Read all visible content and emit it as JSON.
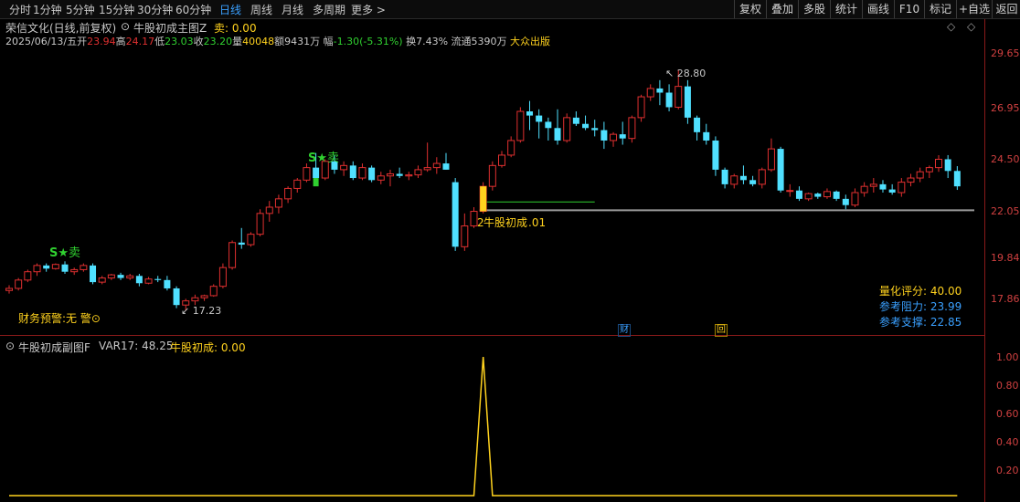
{
  "toolbar": {
    "timeframes": [
      "分时",
      "1分钟",
      "5分钟",
      "15分钟",
      "30分钟",
      "60分钟",
      "日线",
      "周线",
      "月线",
      "多周期",
      "更多"
    ],
    "active_timeframe": "日线",
    "more_arrow": ">",
    "tools": [
      "复权",
      "叠加",
      "多股",
      "统计",
      "画线",
      "F10",
      "标记",
      "+自选",
      "返回"
    ]
  },
  "header": {
    "stock_title": "荣信文化(日线,前复权)",
    "indicator_name": "牛股初成主图Z",
    "indicator_value": "卖: 0.00",
    "date": "2025/06/13/五",
    "open_label": "开",
    "open": "23.94",
    "high_label": "高",
    "high": "24.17",
    "low_label": "低",
    "low": "23.03",
    "close_label": "收",
    "close": "23.20",
    "volume_label": "量",
    "volume": "40048",
    "amount_label": "额",
    "amount": "9431万",
    "change_label": "幅",
    "change": "-1.30(-5.31%)",
    "turnover_label": "换",
    "turnover": "7.43%",
    "float_label": "流通",
    "float": "5390万",
    "sector": "大众出版"
  },
  "y_axis_main": [
    "29.65",
    "26.95",
    "24.50",
    "22.05",
    "19.84",
    "17.86"
  ],
  "y_axis_sub": [
    "1.00",
    "0.80",
    "0.60",
    "0.40",
    "0.20"
  ],
  "chart_data": {
    "type": "candlestick",
    "price_axis_ticks": [
      29.65,
      26.95,
      24.5,
      22.05,
      19.84,
      17.86
    ],
    "ohlc": [
      [
        18.2,
        18.45,
        18.05,
        18.3
      ],
      [
        18.3,
        18.8,
        18.2,
        18.7
      ],
      [
        18.7,
        19.2,
        18.6,
        19.1
      ],
      [
        19.1,
        19.5,
        18.9,
        19.4
      ],
      [
        19.4,
        19.5,
        19.1,
        19.25
      ],
      [
        19.25,
        19.5,
        19.2,
        19.45
      ],
      [
        19.45,
        19.6,
        19.0,
        19.1
      ],
      [
        19.1,
        19.3,
        18.95,
        19.2
      ],
      [
        19.2,
        19.5,
        19.1,
        19.4
      ],
      [
        19.4,
        19.5,
        18.5,
        18.6
      ],
      [
        18.6,
        18.9,
        18.5,
        18.8
      ],
      [
        18.8,
        19.0,
        18.7,
        18.95
      ],
      [
        18.95,
        19.05,
        18.7,
        18.8
      ],
      [
        18.8,
        19.0,
        18.7,
        18.9
      ],
      [
        18.9,
        19.0,
        18.4,
        18.55
      ],
      [
        18.55,
        18.85,
        18.5,
        18.75
      ],
      [
        18.75,
        18.9,
        18.6,
        18.7
      ],
      [
        18.7,
        18.9,
        18.2,
        18.3
      ],
      [
        18.3,
        18.4,
        17.35,
        17.5
      ],
      [
        17.5,
        17.8,
        17.23,
        17.7
      ],
      [
        17.7,
        18.0,
        17.5,
        17.85
      ],
      [
        17.85,
        18.0,
        17.7,
        17.95
      ],
      [
        17.95,
        18.5,
        17.9,
        18.4
      ],
      [
        18.4,
        19.5,
        18.3,
        19.3
      ],
      [
        19.3,
        20.6,
        19.2,
        20.5
      ],
      [
        20.5,
        21.2,
        20.2,
        20.4
      ],
      [
        20.4,
        21.0,
        20.3,
        20.9
      ],
      [
        20.9,
        22.1,
        20.8,
        21.9
      ],
      [
        21.9,
        22.5,
        21.5,
        22.2
      ],
      [
        22.2,
        22.8,
        21.9,
        22.6
      ],
      [
        22.6,
        23.2,
        22.4,
        23.1
      ],
      [
        23.1,
        23.6,
        22.9,
        23.5
      ],
      [
        23.5,
        24.3,
        23.4,
        24.1
      ],
      [
        24.1,
        24.8,
        23.4,
        23.6
      ],
      [
        23.6,
        24.5,
        23.5,
        24.4
      ],
      [
        24.4,
        24.7,
        23.8,
        24.0
      ],
      [
        24.0,
        24.4,
        23.7,
        24.2
      ],
      [
        24.2,
        24.4,
        23.5,
        23.6
      ],
      [
        23.6,
        24.3,
        23.5,
        24.1
      ],
      [
        24.1,
        24.2,
        23.4,
        23.5
      ],
      [
        23.5,
        23.9,
        23.3,
        23.7
      ],
      [
        23.7,
        24.0,
        23.2,
        23.8
      ],
      [
        23.8,
        24.1,
        23.6,
        23.7
      ],
      [
        23.7,
        23.9,
        23.5,
        23.75
      ],
      [
        23.75,
        24.2,
        23.6,
        24.0
      ],
      [
        24.0,
        25.3,
        23.9,
        24.1
      ],
      [
        24.1,
        24.6,
        23.8,
        24.3
      ],
      [
        24.3,
        24.8,
        24.0,
        24.0
      ],
      [
        23.4,
        23.6,
        20.1,
        20.3
      ],
      [
        20.3,
        21.9,
        20.1,
        21.3
      ],
      [
        21.3,
        22.2,
        21.2,
        22.0
      ],
      [
        22.0,
        23.4,
        21.9,
        23.2
      ],
      [
        23.2,
        24.4,
        23.0,
        24.2
      ],
      [
        24.2,
        24.9,
        24.1,
        24.7
      ],
      [
        24.7,
        25.6,
        24.6,
        25.4
      ],
      [
        25.4,
        27.0,
        25.3,
        26.8
      ],
      [
        26.8,
        27.3,
        25.9,
        26.6
      ],
      [
        26.6,
        26.9,
        25.5,
        26.3
      ],
      [
        26.3,
        26.5,
        25.4,
        26.0
      ],
      [
        26.0,
        26.9,
        25.2,
        25.4
      ],
      [
        25.4,
        26.7,
        25.3,
        26.5
      ],
      [
        26.5,
        26.8,
        26.1,
        26.2
      ],
      [
        26.2,
        26.6,
        25.9,
        26.0
      ],
      [
        26.0,
        26.4,
        25.6,
        25.9
      ],
      [
        25.9,
        26.3,
        25.0,
        25.4
      ],
      [
        25.4,
        25.8,
        25.1,
        25.7
      ],
      [
        25.7,
        26.3,
        25.2,
        25.5
      ],
      [
        25.5,
        26.6,
        25.3,
        26.5
      ],
      [
        26.5,
        27.6,
        26.3,
        27.5
      ],
      [
        27.5,
        28.1,
        27.3,
        27.9
      ],
      [
        27.9,
        28.3,
        27.1,
        27.7
      ],
      [
        27.7,
        28.1,
        26.8,
        27.0
      ],
      [
        27.0,
        28.8,
        26.9,
        28.0
      ],
      [
        28.0,
        28.3,
        26.2,
        26.5
      ],
      [
        26.5,
        26.6,
        25.4,
        25.8
      ],
      [
        25.8,
        26.2,
        25.2,
        25.4
      ],
      [
        25.4,
        25.6,
        23.7,
        24.0
      ],
      [
        24.0,
        24.1,
        23.1,
        23.3
      ],
      [
        23.3,
        23.8,
        23.1,
        23.7
      ],
      [
        23.7,
        24.2,
        23.3,
        23.5
      ],
      [
        23.5,
        23.7,
        23.2,
        23.3
      ],
      [
        23.3,
        24.1,
        23.1,
        24.0
      ],
      [
        24.0,
        25.5,
        23.9,
        25.0
      ],
      [
        25.0,
        25.1,
        22.9,
        23.0
      ],
      [
        23.0,
        23.3,
        22.7,
        23.0
      ],
      [
        23.0,
        23.2,
        22.5,
        22.6
      ],
      [
        22.6,
        22.9,
        22.5,
        22.85
      ],
      [
        22.85,
        22.9,
        22.6,
        22.7
      ],
      [
        22.7,
        23.1,
        22.6,
        22.95
      ],
      [
        22.95,
        23.0,
        22.5,
        22.6
      ],
      [
        22.6,
        22.8,
        22.1,
        22.3
      ],
      [
        22.3,
        23.1,
        22.2,
        22.9
      ],
      [
        22.9,
        23.4,
        22.7,
        23.2
      ],
      [
        23.2,
        23.6,
        22.9,
        23.3
      ],
      [
        23.3,
        23.5,
        22.9,
        23.05
      ],
      [
        23.05,
        23.3,
        22.8,
        22.9
      ],
      [
        22.9,
        23.6,
        22.7,
        23.4
      ],
      [
        23.4,
        23.8,
        23.2,
        23.6
      ],
      [
        23.6,
        24.1,
        23.4,
        23.9
      ],
      [
        23.9,
        24.2,
        23.6,
        24.1
      ],
      [
        24.1,
        24.7,
        23.9,
        24.5
      ],
      [
        24.5,
        24.7,
        23.6,
        23.94
      ],
      [
        23.94,
        24.17,
        23.03,
        23.2
      ]
    ],
    "annotations": [
      {
        "label": "S",
        "extra": "卖",
        "index": 7
      },
      {
        "label": "S",
        "extra": "卖",
        "index": 34
      },
      {
        "label": "最高",
        "value": "28.80",
        "index": 72
      },
      {
        "label": "最低",
        "value": "17.23",
        "index": 19
      }
    ],
    "signal_label": "牛股初成",
    "signal_value": "2",
    "signal_value_tail": ".01",
    "support_level": 22.05,
    "sub_indicator": {
      "type": "line",
      "title": "牛股初成副图F",
      "var_text": "VAR17: 48.25",
      "value_text": "牛股初成: 0.00",
      "ylim": [
        0,
        1.0
      ],
      "spike_index": 51,
      "spike_value": 1.0
    }
  },
  "info_panel": {
    "score_label": "量化评分:",
    "score": "40.00",
    "resist_label": "参考阻力:",
    "resist": "23.99",
    "support_label": "参考支撑:",
    "support": "22.85"
  },
  "warning": {
    "text": "财务预警:",
    "value": "无 警",
    "icon": "⊙"
  },
  "badges": {
    "finance": "财",
    "back": "回"
  },
  "high_marker": "28.80",
  "low_marker": "17.23",
  "diamond_icons": [
    "◇",
    "◇"
  ],
  "colors": {
    "up": "#e03030",
    "down": "#50e0ff",
    "grid_red": "#8a1a1a",
    "signal_yellow": "#ffd21e",
    "active_blue": "#3aa0ff",
    "green": "#30d030",
    "support_line": "#9a9a9a"
  }
}
